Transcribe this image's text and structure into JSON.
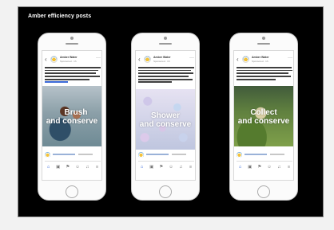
{
  "slide": {
    "title": "Amber efficiency posts"
  },
  "posts": [
    {
      "page_name": "Amber Water",
      "meta": "Sponsored · 1h",
      "caption_line1": "Brush",
      "caption_line2": "and conserve",
      "image_theme": "child brushing teeth with parent"
    },
    {
      "page_name": "Amber Water",
      "meta": "Sponsored · 1h",
      "caption_line1": "Shower",
      "caption_line2": "and conserve",
      "image_theme": "shower curtain"
    },
    {
      "page_name": "Amber Water",
      "meta": "Sponsored · 1h",
      "caption_line1": "Collect",
      "caption_line2": "and conserve",
      "image_theme": "child in garden"
    }
  ],
  "icons": {
    "back": "chevron-left-icon",
    "more": "more-icon",
    "nav": [
      "home-icon",
      "video-icon",
      "flag-icon",
      "people-icon",
      "bell-icon",
      "menu-icon"
    ]
  },
  "colors": {
    "slide_bg": "#000000",
    "link": "#3b69d6",
    "nav_active": "#2f62d8"
  }
}
